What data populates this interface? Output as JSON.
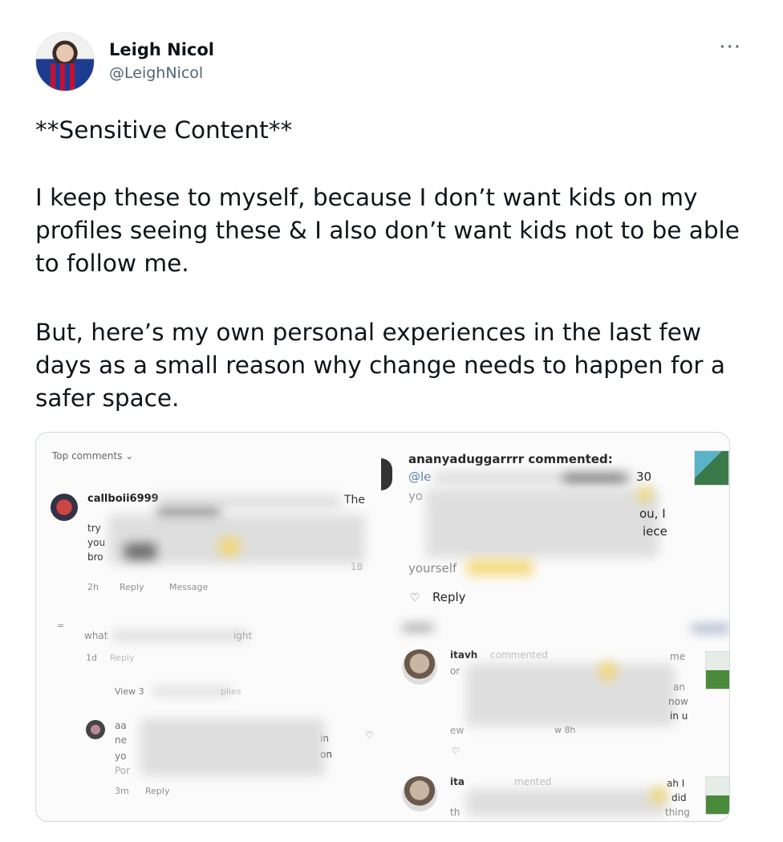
{
  "tweet": {
    "display_name": "Leigh Nicol",
    "handle": "@LeighNicol",
    "more_label": "···",
    "text_1": "**Sensitive Content**",
    "text_2": "I keep these to myself, because I don’t want kids on my profiles seeing these & I also don’t want kids not to be able to follow me.",
    "text_3": "But, here’s my own personal experiences in the last few days as a small reason why change needs to happen for a safer space."
  },
  "media": {
    "left": {
      "top_comments": "Top comments ⌄",
      "c1_user": "callboii6999",
      "c1_end": "The",
      "c1_line2": "try",
      "c1_line3": "you",
      "c1_line4": "bro",
      "c1_num": "18",
      "c1_time": "2h",
      "c1_reply": "Reply",
      "c1_message": "Message",
      "c2_text": "what",
      "c2_right": "ight",
      "c2_time": "1d",
      "c2_reply": "Reply",
      "view_replies": "View 3",
      "view_replies_end": "plies",
      "c3_line1": "aa",
      "c3_line2": "ne",
      "c3_line2_end": "in",
      "c3_line3": "yo",
      "c3_line3_end": "on",
      "c3_line4": "Por",
      "c3_time": "3m",
      "c3_reply": "Reply"
    },
    "right": {
      "c1_header": "ananyaduggarrrr commented:",
      "c1_mention": "@le",
      "c1_num": "30",
      "c1_line2": "yo",
      "c1_line3_end": "ou, I",
      "c1_line4_end": "iece",
      "c1_line6": "yourself",
      "c1_reply": "Reply",
      "c2_header": "itavh",
      "c2_header_end": "commented",
      "c2_end1": "me",
      "c2_line1": "or",
      "c2_end2": "an",
      "c2_end3": "now",
      "c2_end4": "in u",
      "c2_line5": "ew",
      "c2_time": "w 8h",
      "c3_header": "ita",
      "c3_header_mid": "mented",
      "c3_end1": "ah I",
      "c3_end2": "did",
      "c3_line3": "th",
      "c3_end3": "thing"
    }
  }
}
